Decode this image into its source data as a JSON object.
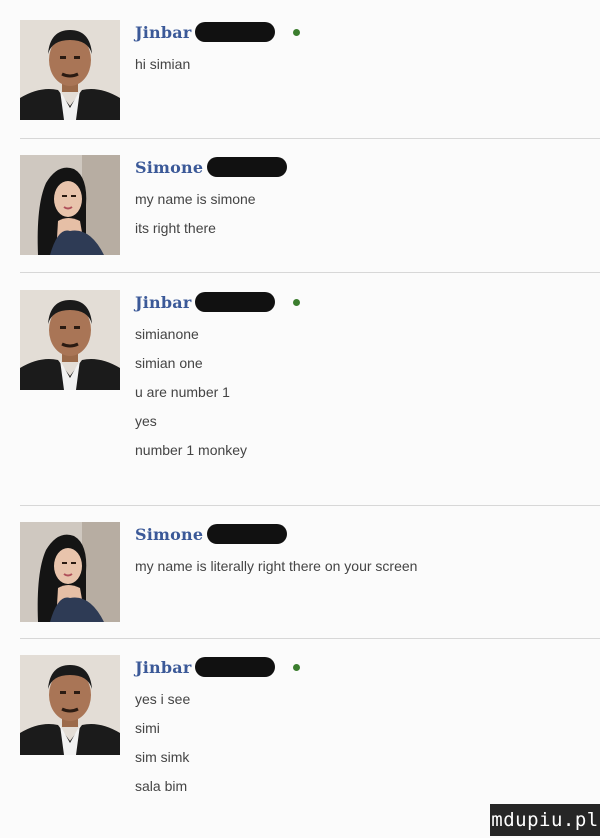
{
  "conversation": [
    {
      "sender": "Jinbar",
      "avatar": "man-avatar",
      "online": true,
      "lines": [
        "hi simian"
      ]
    },
    {
      "sender": "Simone",
      "avatar": "woman-avatar",
      "online": false,
      "lines": [
        "my name is simone",
        "its right there"
      ]
    },
    {
      "sender": "Jinbar",
      "avatar": "man-avatar",
      "online": true,
      "lines": [
        "simianone",
        "simian one",
        "u are number 1",
        "yes",
        "number 1 monkey"
      ]
    },
    {
      "sender": "Simone",
      "avatar": "woman-avatar",
      "online": false,
      "lines": [
        "my name is literally right there on your screen"
      ]
    },
    {
      "sender": "Jinbar",
      "avatar": "man-avatar",
      "online": true,
      "lines": [
        "yes i see",
        "simi",
        "sim simk",
        "sala bim"
      ]
    }
  ],
  "watermark": "mdupiu.pl",
  "colors": {
    "sender_name": "#3b5998",
    "message_text": "#444444",
    "online_dot": "#3b7d2e",
    "redaction": "#111111",
    "divider": "#d7d7d7"
  }
}
